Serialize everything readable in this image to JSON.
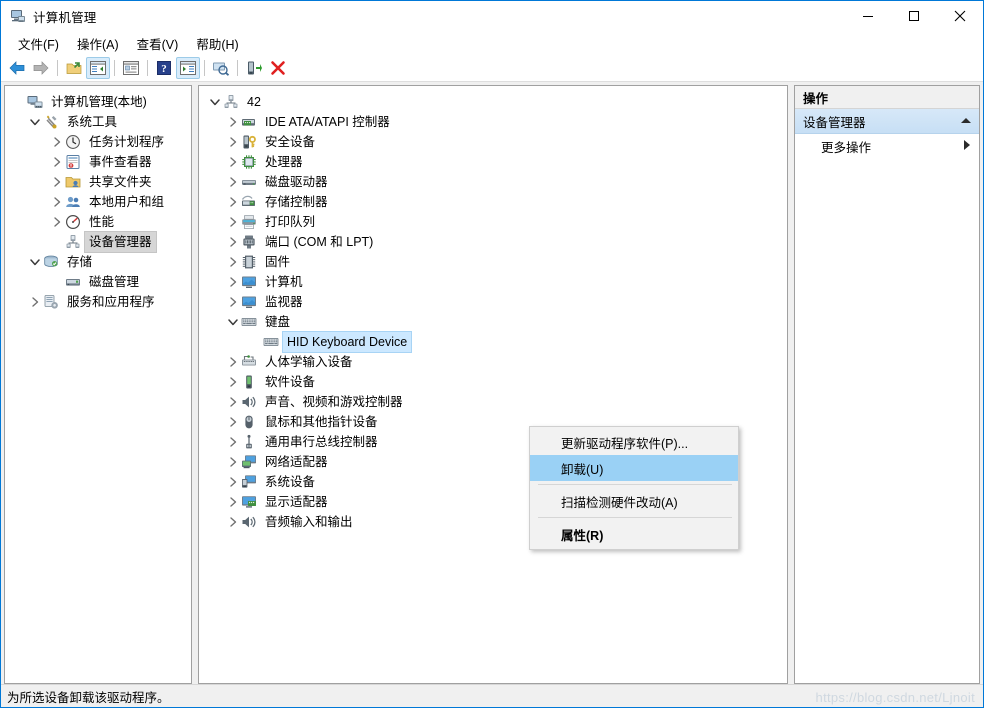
{
  "window": {
    "title": "计算机管理",
    "icon": "computer-management-icon",
    "controls": {
      "minimize": "—",
      "maximize": "☐",
      "close": "✕"
    }
  },
  "menubar": {
    "items": [
      {
        "label": "文件(F)",
        "name": "menu-file"
      },
      {
        "label": "操作(A)",
        "name": "menu-action"
      },
      {
        "label": "查看(V)",
        "name": "menu-view"
      },
      {
        "label": "帮助(H)",
        "name": "menu-help"
      }
    ]
  },
  "toolbar": {
    "buttons": [
      {
        "icon": "back-arrow-icon",
        "name": "toolbar-back",
        "checked": false
      },
      {
        "icon": "forward-arrow-icon",
        "name": "toolbar-forward",
        "checked": false
      },
      {
        "icon": "folder-up-icon",
        "name": "toolbar-up-level",
        "checked": false
      },
      {
        "icon": "show-tree-icon",
        "name": "toolbar-show-tree",
        "checked": true
      },
      {
        "icon": "properties-icon",
        "name": "toolbar-properties",
        "checked": false
      },
      {
        "icon": "help-icon",
        "name": "toolbar-help",
        "checked": false
      },
      {
        "icon": "action-pane-icon",
        "name": "toolbar-action-pane",
        "checked": true
      },
      {
        "icon": "scan-hardware-icon",
        "name": "toolbar-scan-hardware",
        "checked": false
      },
      {
        "icon": "update-driver-icon",
        "name": "toolbar-update-driver",
        "checked": false
      },
      {
        "icon": "uninstall-red-x-icon",
        "name": "toolbar-uninstall",
        "checked": false
      }
    ]
  },
  "console_tree": {
    "items": [
      {
        "label": "计算机管理(本地)",
        "icon": "computer-management-icon",
        "indent": 0,
        "expander": "none",
        "selected": "none",
        "name": "tree-computer-management-local"
      },
      {
        "label": "系统工具",
        "icon": "system-tools-icon",
        "indent": 1,
        "expander": "expanded",
        "selected": "none",
        "name": "tree-system-tools"
      },
      {
        "label": "任务计划程序",
        "icon": "task-scheduler-icon",
        "indent": 2,
        "expander": "collapsed",
        "selected": "none",
        "name": "tree-task-scheduler"
      },
      {
        "label": "事件查看器",
        "icon": "event-viewer-icon",
        "indent": 2,
        "expander": "collapsed",
        "selected": "none",
        "name": "tree-event-viewer"
      },
      {
        "label": "共享文件夹",
        "icon": "shared-folders-icon",
        "indent": 2,
        "expander": "collapsed",
        "selected": "none",
        "name": "tree-shared-folders"
      },
      {
        "label": "本地用户和组",
        "icon": "local-users-groups-icon",
        "indent": 2,
        "expander": "collapsed",
        "selected": "none",
        "name": "tree-local-users-and-groups"
      },
      {
        "label": "性能",
        "icon": "performance-icon",
        "indent": 2,
        "expander": "collapsed",
        "selected": "none",
        "name": "tree-performance"
      },
      {
        "label": "设备管理器",
        "icon": "device-manager-icon",
        "indent": 2,
        "expander": "none",
        "selected": "inactive",
        "name": "tree-device-manager"
      },
      {
        "label": "存储",
        "icon": "storage-icon",
        "indent": 1,
        "expander": "expanded",
        "selected": "none",
        "name": "tree-storage"
      },
      {
        "label": "磁盘管理",
        "icon": "disk-management-icon",
        "indent": 2,
        "expander": "none",
        "selected": "none",
        "name": "tree-disk-management"
      },
      {
        "label": "服务和应用程序",
        "icon": "services-apps-icon",
        "indent": 1,
        "expander": "collapsed",
        "selected": "none",
        "name": "tree-services-and-applications"
      }
    ]
  },
  "device_tree": {
    "root": {
      "label": "42",
      "icon": "device-manager-icon",
      "expander": "expanded",
      "name": "device-tree-root"
    },
    "items": [
      {
        "label": "IDE ATA/ATAPI 控制器",
        "icon": "ide-controller-icon",
        "expander": "collapsed",
        "indent": 1,
        "selected": false,
        "name": "device-node-ide-ata-atapi"
      },
      {
        "label": "安全设备",
        "icon": "security-device-icon",
        "expander": "collapsed",
        "indent": 1,
        "selected": false,
        "name": "device-node-security-devices"
      },
      {
        "label": "处理器",
        "icon": "processor-icon",
        "expander": "collapsed",
        "indent": 1,
        "selected": false,
        "name": "device-node-processors"
      },
      {
        "label": "磁盘驱动器",
        "icon": "disk-drive-icon",
        "expander": "collapsed",
        "indent": 1,
        "selected": false,
        "name": "device-node-disk-drives"
      },
      {
        "label": "存储控制器",
        "icon": "storage-controller-icon",
        "expander": "collapsed",
        "indent": 1,
        "selected": false,
        "name": "device-node-storage-controllers"
      },
      {
        "label": "打印队列",
        "icon": "print-queue-icon",
        "expander": "collapsed",
        "indent": 1,
        "selected": false,
        "name": "device-node-print-queues"
      },
      {
        "label": "端口 (COM 和 LPT)",
        "icon": "ports-icon",
        "expander": "collapsed",
        "indent": 1,
        "selected": false,
        "name": "device-node-ports"
      },
      {
        "label": "固件",
        "icon": "firmware-icon",
        "expander": "collapsed",
        "indent": 1,
        "selected": false,
        "name": "device-node-firmware"
      },
      {
        "label": "计算机",
        "icon": "computer-icon",
        "expander": "collapsed",
        "indent": 1,
        "selected": false,
        "name": "device-node-computer"
      },
      {
        "label": "监视器",
        "icon": "monitor-icon",
        "expander": "collapsed",
        "indent": 1,
        "selected": false,
        "name": "device-node-monitors"
      },
      {
        "label": "键盘",
        "icon": "keyboard-icon",
        "expander": "expanded",
        "indent": 1,
        "selected": false,
        "name": "device-node-keyboards"
      },
      {
        "label": "HID Keyboard Device",
        "icon": "keyboard-icon",
        "expander": "none",
        "indent": 2,
        "selected": true,
        "name": "device-node-hid-keyboard-device"
      },
      {
        "label": "人体学输入设备",
        "icon": "hid-icon",
        "expander": "collapsed",
        "indent": 1,
        "selected": false,
        "name": "device-node-human-interface-devices"
      },
      {
        "label": "软件设备",
        "icon": "software-device-icon",
        "expander": "collapsed",
        "indent": 1,
        "selected": false,
        "name": "device-node-software-devices"
      },
      {
        "label": "声音、视频和游戏控制器",
        "icon": "sound-icon",
        "expander": "collapsed",
        "indent": 1,
        "selected": false,
        "name": "device-node-sound-video-game-controllers"
      },
      {
        "label": "鼠标和其他指针设备",
        "icon": "mouse-icon",
        "expander": "collapsed",
        "indent": 1,
        "selected": false,
        "name": "device-node-mice-and-pointing-devices"
      },
      {
        "label": "通用串行总线控制器",
        "icon": "usb-icon",
        "expander": "collapsed",
        "indent": 1,
        "selected": false,
        "name": "device-node-usb-controllers"
      },
      {
        "label": "网络适配器",
        "icon": "network-adapter-icon",
        "expander": "collapsed",
        "indent": 1,
        "selected": false,
        "name": "device-node-network-adapters"
      },
      {
        "label": "系统设备",
        "icon": "system-device-icon",
        "expander": "collapsed",
        "indent": 1,
        "selected": false,
        "name": "device-node-system-devices"
      },
      {
        "label": "显示适配器",
        "icon": "display-adapter-icon",
        "expander": "collapsed",
        "indent": 1,
        "selected": false,
        "name": "device-node-display-adapters"
      },
      {
        "label": "音频输入和输出",
        "icon": "audio-io-icon",
        "expander": "collapsed",
        "indent": 1,
        "selected": false,
        "name": "device-node-audio-inputs-and-outputs"
      }
    ]
  },
  "context_menu": {
    "items": [
      {
        "label": "更新驱动程序软件(P)...",
        "highlight": false,
        "bold": false,
        "separator_after": false,
        "name": "ctx-update-driver-software"
      },
      {
        "label": "卸载(U)",
        "highlight": true,
        "bold": false,
        "separator_after": true,
        "name": "ctx-uninstall"
      },
      {
        "label": "扫描检测硬件改动(A)",
        "highlight": false,
        "bold": false,
        "separator_after": true,
        "name": "ctx-scan-for-hardware-changes"
      },
      {
        "label": "属性(R)",
        "highlight": false,
        "bold": true,
        "separator_after": false,
        "name": "ctx-properties"
      }
    ]
  },
  "actions_pane": {
    "header": "操作",
    "group": "设备管理器",
    "group_collapse_icon": "chevron-up-icon",
    "items": [
      {
        "label": "更多操作",
        "submenu_icon": "chevron-right-icon",
        "name": "action-more-actions"
      }
    ]
  },
  "statusbar": {
    "text": "为所选设备卸载该驱动程序。"
  },
  "watermark": {
    "text": "https://blog.csdn.net/Ljnoit"
  },
  "colors": {
    "accent": "#0078d7",
    "menu_highlight": "#9ad1f5",
    "tree_selection_active": "#cce8ff",
    "tree_selection_inactive": "#d6d6d6",
    "actions_group": "#cfe4f7",
    "window_bg": "#f0f0f0"
  }
}
